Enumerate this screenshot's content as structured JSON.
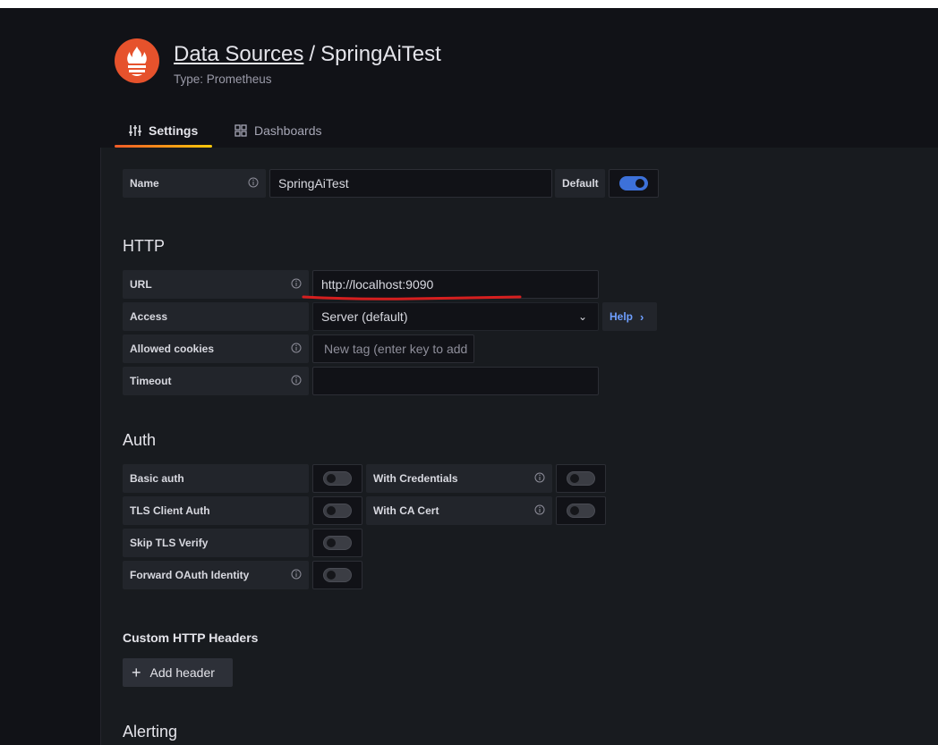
{
  "header": {
    "breadcrumb_link": "Data Sources",
    "separator": "/",
    "name": "SpringAiTest",
    "subtitle": "Type: Prometheus"
  },
  "tabs": [
    {
      "label": "Settings",
      "active": true,
      "icon": "sliders-icon"
    },
    {
      "label": "Dashboards",
      "active": false,
      "icon": "apps-grid-icon"
    }
  ],
  "name_row": {
    "label": "Name",
    "value": "SpringAiTest",
    "default_label": "Default",
    "default_on": true
  },
  "http": {
    "heading": "HTTP",
    "url_label": "URL",
    "url_value": "http://localhost:9090",
    "access_label": "Access",
    "access_value": "Server (default)",
    "help_label": "Help",
    "cookies_label": "Allowed cookies",
    "cookies_placeholder": "New tag (enter key to add",
    "timeout_label": "Timeout",
    "timeout_value": ""
  },
  "auth": {
    "heading": "Auth",
    "basic_auth": "Basic auth",
    "with_credentials": "With Credentials",
    "tls_client_auth": "TLS Client Auth",
    "with_ca_cert": "With CA Cert",
    "skip_tls_verify": "Skip TLS Verify",
    "forward_oauth": "Forward OAuth Identity"
  },
  "headers": {
    "heading": "Custom HTTP Headers",
    "add_label": "Add header"
  },
  "alerting": {
    "heading": "Alerting"
  },
  "colors": {
    "background": "#111217",
    "panel": "#181b1f",
    "accent_blue": "#3d71d9",
    "logo_orange": "#e6522c",
    "annotation_red": "#d61f1f"
  }
}
